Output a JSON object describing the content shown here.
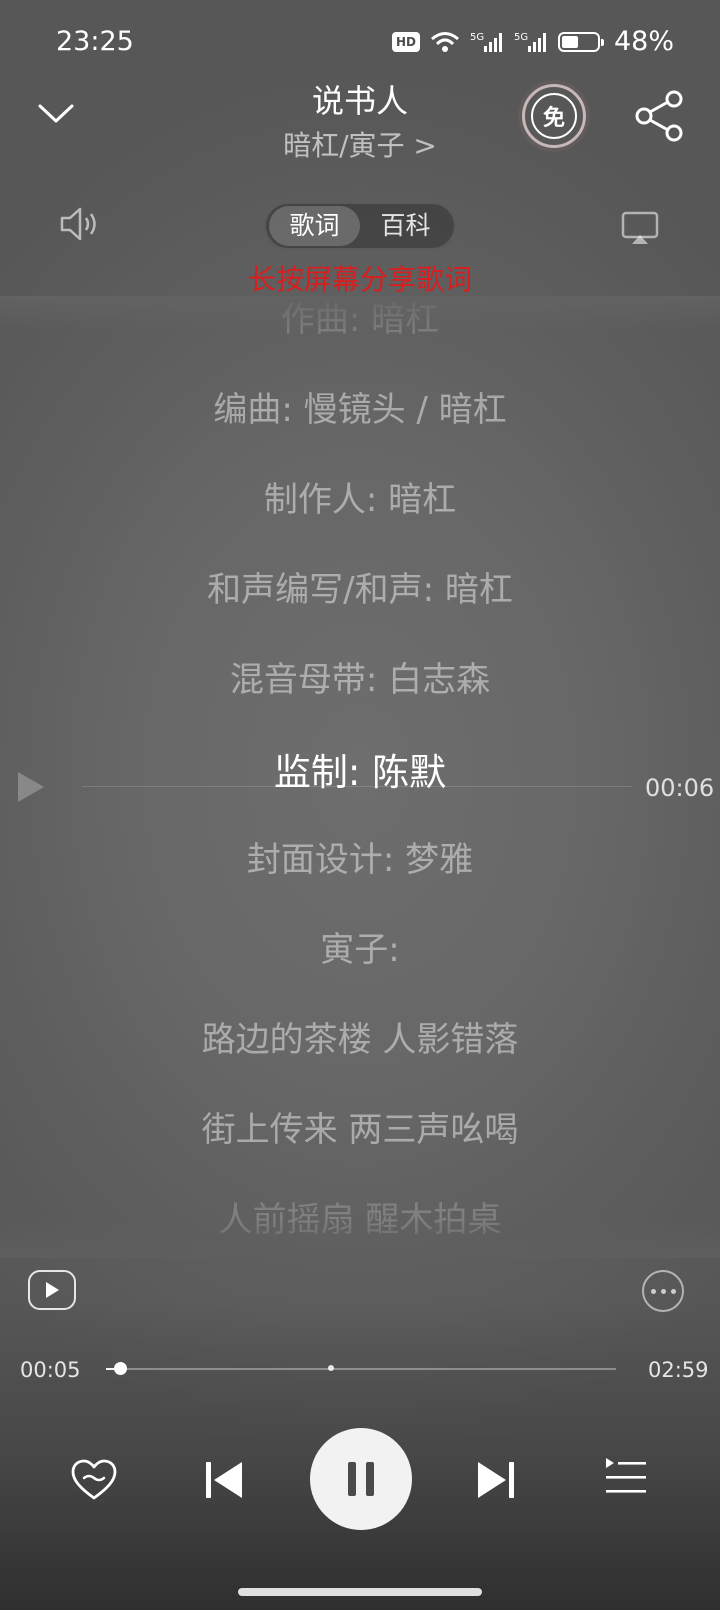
{
  "status_bar": {
    "time": "23:25",
    "hd_label": "HD",
    "network_1": "5G",
    "network_2": "5G",
    "battery_percent_text": "48%",
    "battery_level": 0.48
  },
  "header": {
    "song_title": "说书人",
    "artist_text": "暗杠/寅子 >",
    "free_badge_label": "免"
  },
  "tabs": [
    {
      "label": "歌词",
      "active": true
    },
    {
      "label": "百科",
      "active": false
    }
  ],
  "share_hint": "长按屏幕分享歌词",
  "lyrics": [
    {
      "text": "作曲: 暗杠",
      "state": "fade-top"
    },
    {
      "text": "编曲: 慢镜头 / 暗杠",
      "state": "normal"
    },
    {
      "text": "制作人: 暗杠",
      "state": "normal"
    },
    {
      "text": "和声编写/和声: 暗杠",
      "state": "normal"
    },
    {
      "text": "混音母带: 白志森",
      "state": "normal"
    },
    {
      "text": "监制: 陈默",
      "state": "current"
    },
    {
      "text": "封面设计: 梦雅",
      "state": "normal"
    },
    {
      "text": "寅子:",
      "state": "normal"
    },
    {
      "text": "路边的茶楼 人影错落",
      "state": "normal"
    },
    {
      "text": "街上传来 两三声吆喝",
      "state": "normal"
    },
    {
      "text": "人前摇扇 醒木拍桌",
      "state": "fade-bottom"
    }
  ],
  "lyric_seek_time": "00:06",
  "progress": {
    "elapsed": "00:05",
    "total": "02:59",
    "fraction": 0.028
  },
  "icons": {
    "collapse": "chevron-down-icon",
    "share": "share-icon",
    "volume": "speaker-icon",
    "cast": "cast-icon",
    "like": "heart-icon",
    "prev": "skip-previous-icon",
    "pause": "pause-icon",
    "next": "skip-next-icon",
    "playlist": "playlist-icon",
    "more": "more-icon"
  },
  "colors": {
    "hint_red": "#d81e1e",
    "active_lyric": "#ffffff"
  }
}
